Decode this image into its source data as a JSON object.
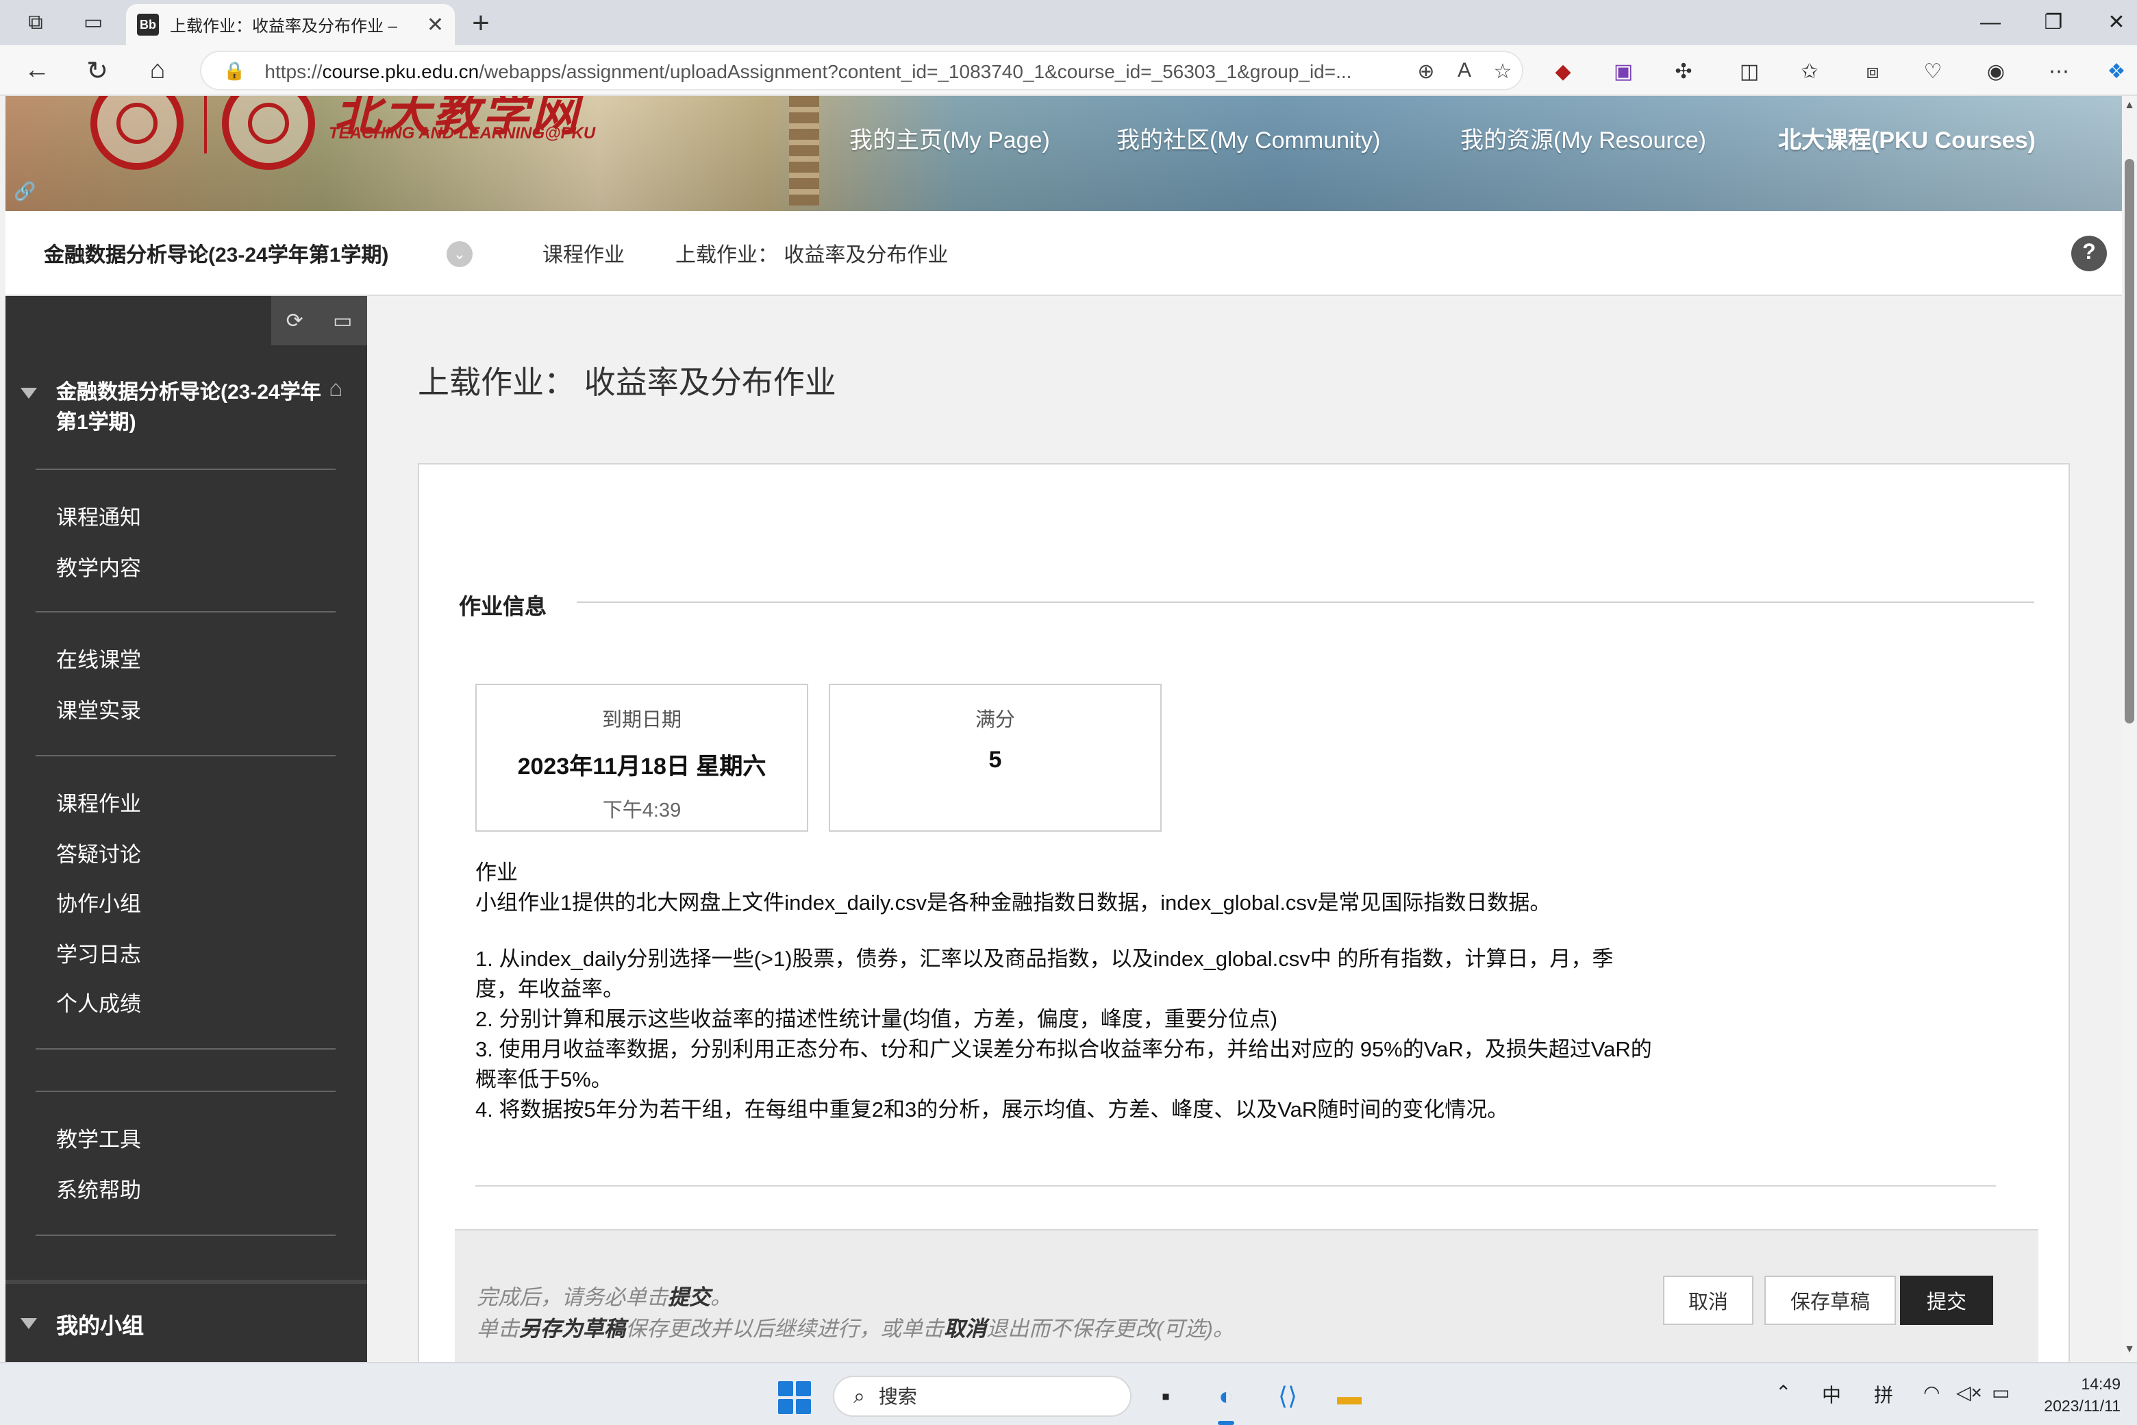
{
  "browser": {
    "tab_title": "上载作业：收益率及分布作业 –",
    "tab_favicon": "Bb",
    "url_prefix": "https://",
    "url_host": "course.pku.edu.cn",
    "url_path": "/webapps/assignment/uploadAssignment?content_id=_1083740_1&course_id=_56303_1&group_id=..."
  },
  "banner": {
    "logo_text_cn": "北大教学网",
    "logo_text_en": "TEACHING AND LEARNING@PKU",
    "nav": [
      {
        "label": "我的主页(My Page)"
      },
      {
        "label": "我的社区(My Community)"
      },
      {
        "label": "我的资源(My Resource)"
      },
      {
        "label": "北大课程(PKU Courses)"
      }
    ]
  },
  "breadcrumb": {
    "course": "金融数据分析导论(23-24学年第1学期)",
    "items": [
      "课程作业",
      "上载作业： 收益率及分布作业"
    ]
  },
  "sidebar": {
    "course_title": "金融数据分析导论(23-24学年第1学期)",
    "groups": [
      [
        "课程通知",
        "教学内容"
      ],
      [
        "在线课堂",
        "课堂实录"
      ],
      [
        "课程作业",
        "答疑讨论",
        "协作小组",
        "学习日志",
        "个人成绩"
      ],
      [
        "教学工具",
        "系统帮助"
      ]
    ],
    "my_groups": "我的小组"
  },
  "main": {
    "page_title": "上载作业： 收益率及分布作业",
    "section_label": "作业信息",
    "due": {
      "label": "到期日期",
      "date": "2023年11月18日 星期六",
      "time": "下午4:39"
    },
    "points": {
      "label": "满分",
      "value": "5"
    },
    "description": {
      "heading": "作业",
      "intro": "小组作业1提供的北大网盘上文件index_daily.csv是各种金融指数日数据，index_global.csv是常见国际指数日数据。",
      "items": [
        "1. 从index_daily分别选择一些(>1)股票，债券，汇率以及商品指数，以及index_global.csv中 的所有指数，计算日，月，季度，年收益率。",
        "2. 分别计算和展示这些收益率的描述性统计量(均值，方差，偏度，峰度，重要分位点)",
        "3. 使用月收益率数据，分别利用正态分布、t分和广义误差分布拟合收益率分布，并给出对应的 95%的VaR，及损失超过VaR的概率低于5%。",
        "4. 将数据按5年分为若干组，在每组中重复2和3的分析，展示均值、方差、峰度、以及VaR随时间的变化情况。"
      ]
    },
    "submit": {
      "note1_a": "完成后，请务必单击",
      "note1_b": "提交",
      "note1_c": "。",
      "note2_a": "单击",
      "note2_b": "另存为草稿",
      "note2_c": "保存更改并以后继续进行，或单击",
      "note2_d": "取消",
      "note2_e": "退出而不保存更改(可选)。",
      "cancel": "取消",
      "save_draft": "保存草稿",
      "submit": "提交"
    }
  },
  "taskbar": {
    "search_placeholder": "搜索",
    "tray": {
      "ime_lang": "中",
      "ime_mode": "拼"
    },
    "time": "14:49",
    "date": "2023/11/11"
  },
  "colors": {
    "accent_red": "#b21c1c",
    "sidebar_bg": "#333333",
    "primary_button": "#262626"
  }
}
